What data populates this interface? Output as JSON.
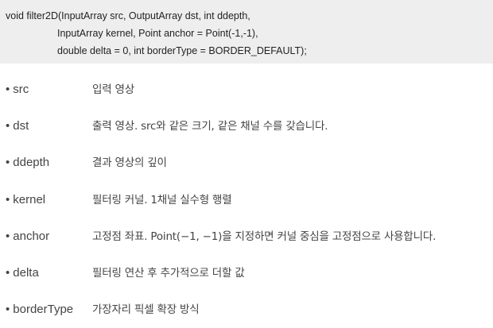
{
  "signature": {
    "lines": [
      "void filter2D(InputArray src, OutputArray dst, int ddepth,",
      "InputArray kernel, Point anchor = Point(-1,-1),",
      "double delta = 0, int borderType = BORDER_DEFAULT);"
    ]
  },
  "params": [
    {
      "bullet": "•",
      "name": "src",
      "desc": "입력 영상"
    },
    {
      "bullet": "•",
      "name": "dst",
      "desc": "출력 영상. src와 같은 크기, 같은 채널 수를 갖습니다."
    },
    {
      "bullet": "•",
      "name": "ddepth",
      "desc": "결과 영상의 깊이"
    },
    {
      "bullet": "•",
      "name": "kernel",
      "desc": "필터링 커널. 1채널 실수형 행렬"
    },
    {
      "bullet": "•",
      "name": "anchor",
      "desc": "고정점 좌표. Point(−1, −1)을 지정하면 커널 중심을 고정점으로 사용합니다."
    },
    {
      "bullet": "•",
      "name": "delta",
      "desc": "필터링 연산 후 추가적으로 더할 값"
    },
    {
      "bullet": "•",
      "name": "borderType",
      "desc": "가장자리 픽셀 확장 방식"
    }
  ]
}
